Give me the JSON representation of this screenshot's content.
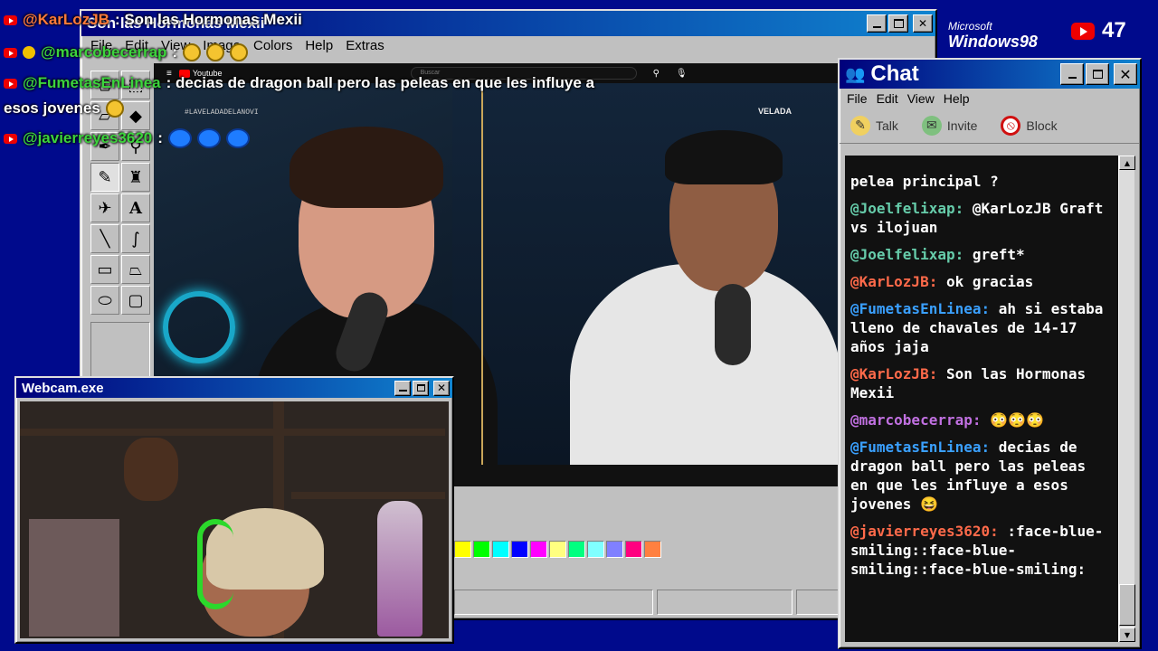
{
  "paint": {
    "title": "Son las Hormonas Mexii",
    "menu": [
      "File",
      "Edit",
      "View",
      "Image",
      "Colors",
      "Help",
      "Extras"
    ],
    "tools": [
      "free-select",
      "rect-select",
      "eraser",
      "fill",
      "picker",
      "magnifier",
      "pencil",
      "brush",
      "airbrush",
      "text",
      "line",
      "curve",
      "rectangle",
      "polygon",
      "ellipse",
      "rounded-rect"
    ],
    "palette": [
      "#ffff00",
      "#00ff00",
      "#00ffff",
      "#0000ff",
      "#ff00ff",
      "#ffff80",
      "#00ff80",
      "#80ffff",
      "#8080ff",
      "#ff0080",
      "#ff8040"
    ]
  },
  "youtube": {
    "logo": "Youtube",
    "search_placeholder": "Buscar",
    "hashtag": "#LAVELADADELANOVI",
    "brand": "VELADA"
  },
  "webcam": {
    "title": "Webcam.exe"
  },
  "chat": {
    "title": "Chat",
    "menu": [
      "File",
      "Edit",
      "View",
      "Help"
    ],
    "tools": [
      {
        "label": "Talk",
        "icon": "talk-icon"
      },
      {
        "label": "Invite",
        "icon": "invite-icon"
      },
      {
        "label": "Block",
        "icon": "block-icon"
      }
    ],
    "messages": [
      {
        "user": "",
        "color": "#ffffff",
        "text": "pelea principal ?"
      },
      {
        "user": "@Joelfelixap:",
        "color": "#66ccaa",
        "text": "@KarLozJB Graft vs ilojuan"
      },
      {
        "user": "@Joelfelixap:",
        "color": "#66ccaa",
        "text": "greft*"
      },
      {
        "user": "@KarLozJB:",
        "color": "#ff6a4a",
        "text": "ok gracias"
      },
      {
        "user": "@FumetasEnLinea:",
        "color": "#3aa0ff",
        "text": "ah si estaba lleno de chavales de 14-17 años jaja"
      },
      {
        "user": "@KarLozJB:",
        "color": "#ff6a4a",
        "text": "Son las Hormonas Mexii"
      },
      {
        "user": "@marcobecerrap:",
        "color": "#c070e0",
        "text": "😳😳😳"
      },
      {
        "user": "@FumetasEnLinea:",
        "color": "#3aa0ff",
        "text": "decias de dragon ball pero las peleas en que les influye a esos jovenes 😆"
      },
      {
        "user": "@javierreyes3620:",
        "color": "#ff6a4a",
        "text": ":face-blue-smiling::face-blue-smiling::face-blue-smiling:"
      }
    ]
  },
  "overlay": {
    "lines": [
      {
        "user": "@KarLozJB",
        "text": ": Son las Hormonas Mexii"
      },
      {
        "user": "@marcobecerrap",
        "text": ":"
      },
      {
        "user": "@FumetasEnLinea",
        "text": ": decias de dragon ball pero las peleas en que les influye a"
      },
      {
        "user": "",
        "text": "esos jovenes"
      },
      {
        "user": "@javierreyes3620",
        "text": ":"
      }
    ]
  },
  "branding": {
    "microsoft": "Microsoft",
    "windows": "Windows98",
    "viewer_count": "47"
  }
}
